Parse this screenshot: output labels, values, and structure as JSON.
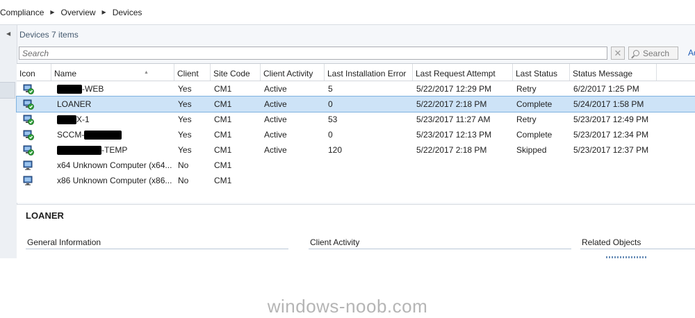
{
  "breadcrumb": {
    "items": [
      "Compliance",
      "Overview",
      "Devices"
    ]
  },
  "panel": {
    "title": "Devices",
    "count": "7 items",
    "search_placeholder": "Search",
    "search_button": "Search",
    "add_link": "Ad"
  },
  "grid": {
    "columns": [
      "Icon",
      "Name",
      "Client",
      "Site Code",
      "Client Activity",
      "Last Installation Error",
      "Last Request Attempt",
      "Last Status",
      "Status Message"
    ],
    "sorted_column": "Name",
    "rows": [
      {
        "name_prefix": "",
        "name": "-WEB",
        "client": "Yes",
        "site_code": "CM1",
        "activity": "Active",
        "last_install_error": "5",
        "last_request": "5/22/2017 12:29 PM",
        "last_status": "Retry",
        "status_message": "6/2/2017 1:25 PM",
        "icon": "client-device-icon",
        "selected": false
      },
      {
        "name_prefix": "",
        "name": "LOANER",
        "client": "Yes",
        "site_code": "CM1",
        "activity": "Active",
        "last_install_error": "0",
        "last_request": "5/22/2017 2:18 PM",
        "last_status": "Complete",
        "status_message": "5/24/2017 1:58 PM",
        "icon": "client-device-icon",
        "selected": true
      },
      {
        "name_prefix": "",
        "name": "X-1",
        "client": "Yes",
        "site_code": "CM1",
        "activity": "Active",
        "last_install_error": "53",
        "last_request": "5/23/2017 11:27 AM",
        "last_status": "Retry",
        "status_message": "5/23/2017 12:49 PM",
        "icon": "client-device-icon",
        "selected": false
      },
      {
        "name_prefix": "SCCM-",
        "name": "",
        "client": "Yes",
        "site_code": "CM1",
        "activity": "Active",
        "last_install_error": "0",
        "last_request": "5/23/2017 12:13 PM",
        "last_status": "Complete",
        "status_message": "5/23/2017 12:34 PM",
        "icon": "client-device-icon",
        "selected": false
      },
      {
        "name_prefix": "",
        "name": "-TEMP",
        "client": "Yes",
        "site_code": "CM1",
        "activity": "Active",
        "last_install_error": "120",
        "last_request": "5/22/2017 2:18 PM",
        "last_status": "Skipped",
        "status_message": "5/23/2017 12:37 PM",
        "icon": "client-device-icon",
        "selected": false
      },
      {
        "name_prefix": "",
        "name": "x64 Unknown Computer (x64...",
        "client": "No",
        "site_code": "CM1",
        "activity": "",
        "last_install_error": "",
        "last_request": "",
        "last_status": "",
        "status_message": "",
        "icon": "unknown-device-icon",
        "selected": false
      },
      {
        "name_prefix": "",
        "name": "x86 Unknown Computer (x86...",
        "client": "No",
        "site_code": "CM1",
        "activity": "",
        "last_install_error": "",
        "last_request": "",
        "last_status": "",
        "status_message": "",
        "icon": "unknown-device-icon",
        "selected": false
      }
    ]
  },
  "details": {
    "title": "LOANER",
    "sections": [
      "General Information",
      "Client Activity",
      "Related Objects"
    ]
  },
  "watermark": "windows-noob.com",
  "colors": {
    "selected_row": "#cde3f7",
    "selected_border": "#7fb2e0",
    "link": "#1f5bb5",
    "panel_title": "#44596e"
  }
}
